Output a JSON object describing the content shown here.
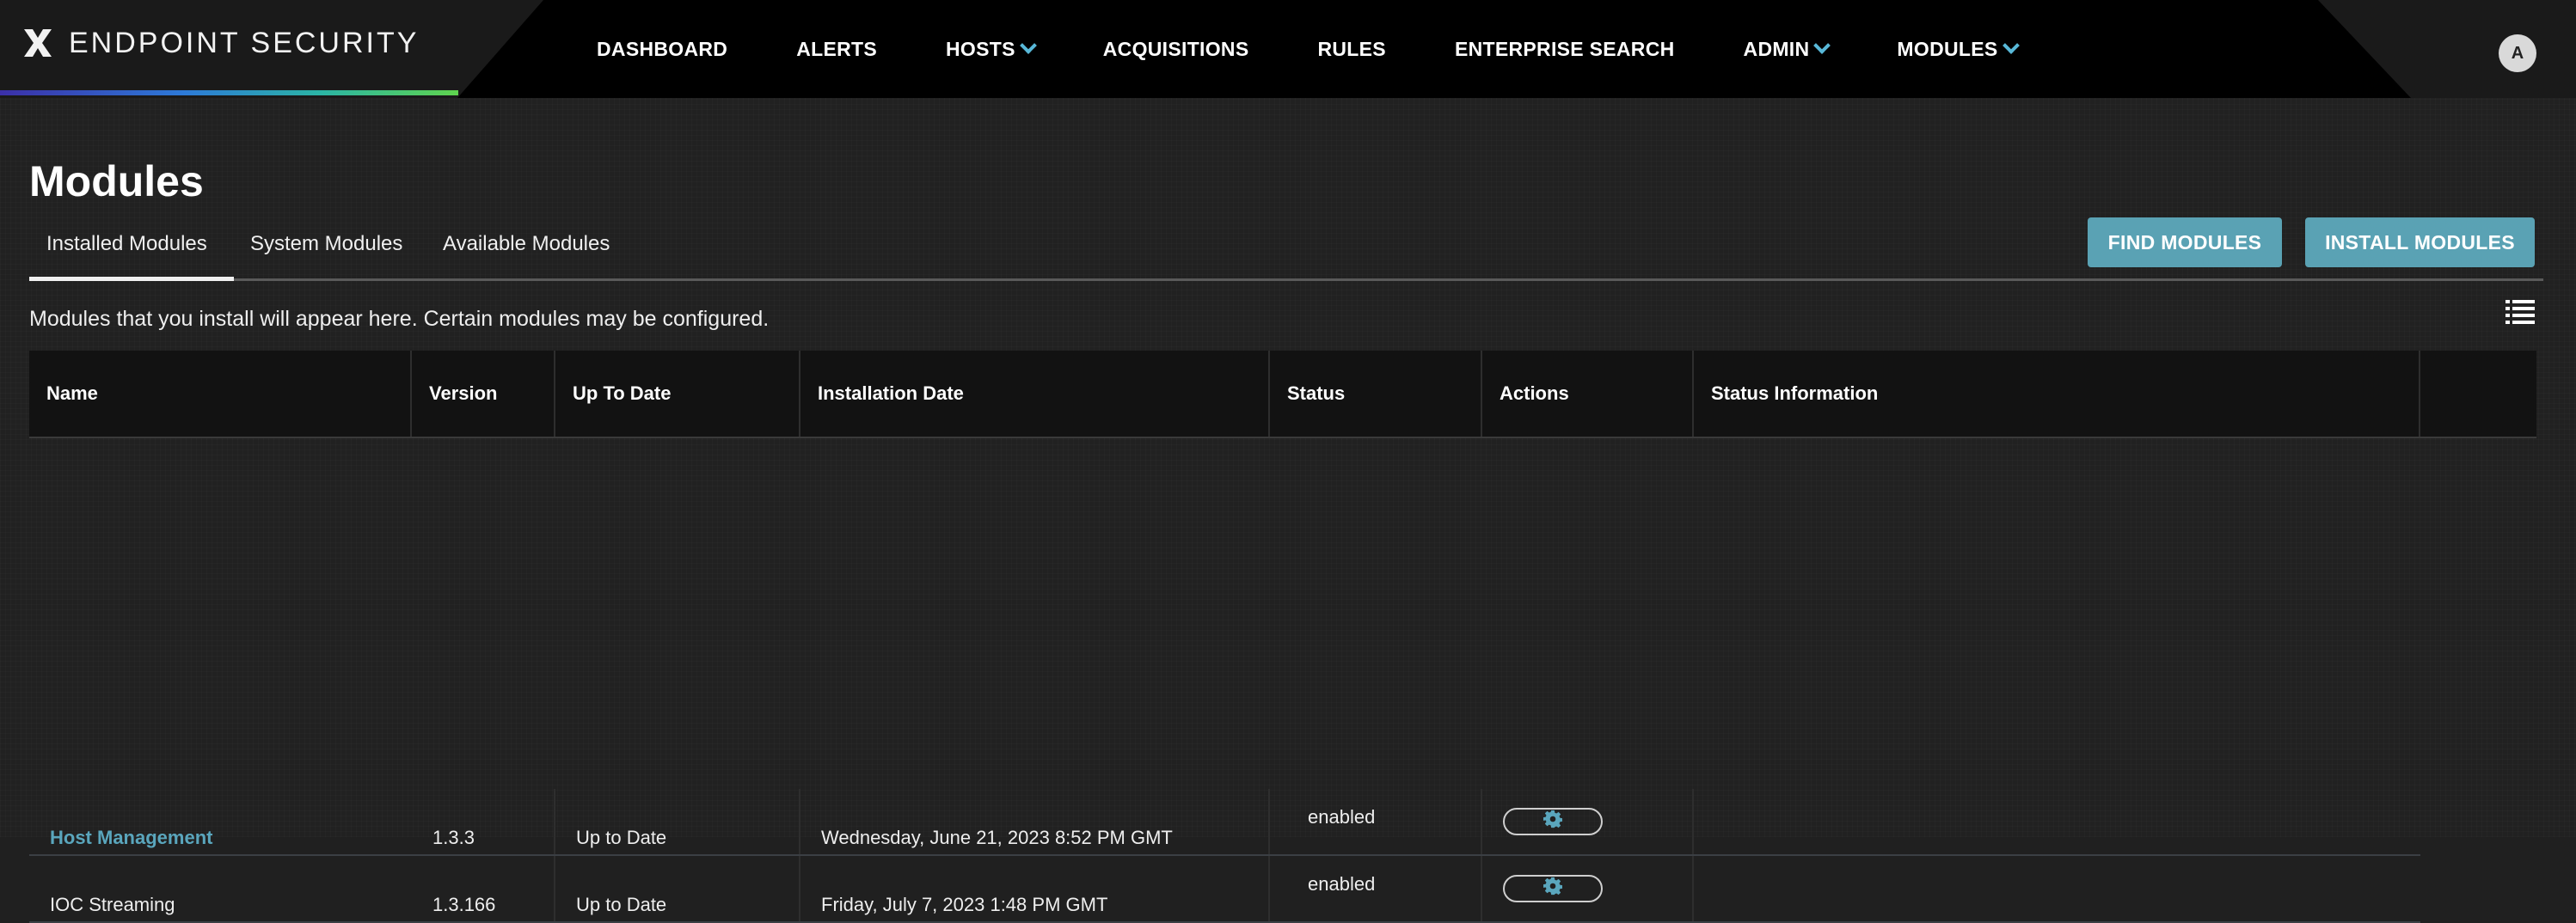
{
  "app": {
    "title": "ENDPOINT SECURITY",
    "avatar_initial": "A"
  },
  "nav": {
    "items": [
      {
        "label": "DASHBOARD",
        "dropdown": false
      },
      {
        "label": "ALERTS",
        "dropdown": false
      },
      {
        "label": "HOSTS",
        "dropdown": true
      },
      {
        "label": "ACQUISITIONS",
        "dropdown": false
      },
      {
        "label": "RULES",
        "dropdown": false
      },
      {
        "label": "ENTERPRISE SEARCH",
        "dropdown": false
      },
      {
        "label": "ADMIN",
        "dropdown": true
      },
      {
        "label": "MODULES",
        "dropdown": true
      }
    ]
  },
  "page": {
    "title": "Modules",
    "tabs": [
      {
        "label": "Installed Modules",
        "active": true
      },
      {
        "label": "System Modules",
        "active": false
      },
      {
        "label": "Available Modules",
        "active": false
      }
    ],
    "buttons": {
      "find": "FIND MODULES",
      "install": "INSTALL MODULES"
    },
    "description": "Modules that you install will appear here. Certain modules may be configured."
  },
  "table": {
    "columns": [
      "Name",
      "Version",
      "Up To Date",
      "Installation Date",
      "Status",
      "Actions",
      "Status Information"
    ],
    "rows": [
      {
        "name": "Host Management",
        "version": "1.3.3",
        "up_to_date": "Up to Date",
        "installation_date": "Wednesday, June 21, 2023 8:52 PM GMT",
        "status": "enabled",
        "status_information": "",
        "link": true
      },
      {
        "name": "IOC Streaming",
        "version": "1.3.166",
        "up_to_date": "Up to Date",
        "installation_date": "Friday, July 7, 2023 1:48 PM GMT",
        "status": "enabled",
        "status_information": "",
        "link": false
      }
    ]
  },
  "colors": {
    "accent": "#5aa2b4",
    "link": "#5aa6bd",
    "chevron": "#58b8d8",
    "header_bg": "#000000"
  },
  "icons": {
    "logo": "x-logo-icon",
    "actions": "gear-icon",
    "list_view": "list-view-icon",
    "dropdown": "chevron-down-icon"
  }
}
